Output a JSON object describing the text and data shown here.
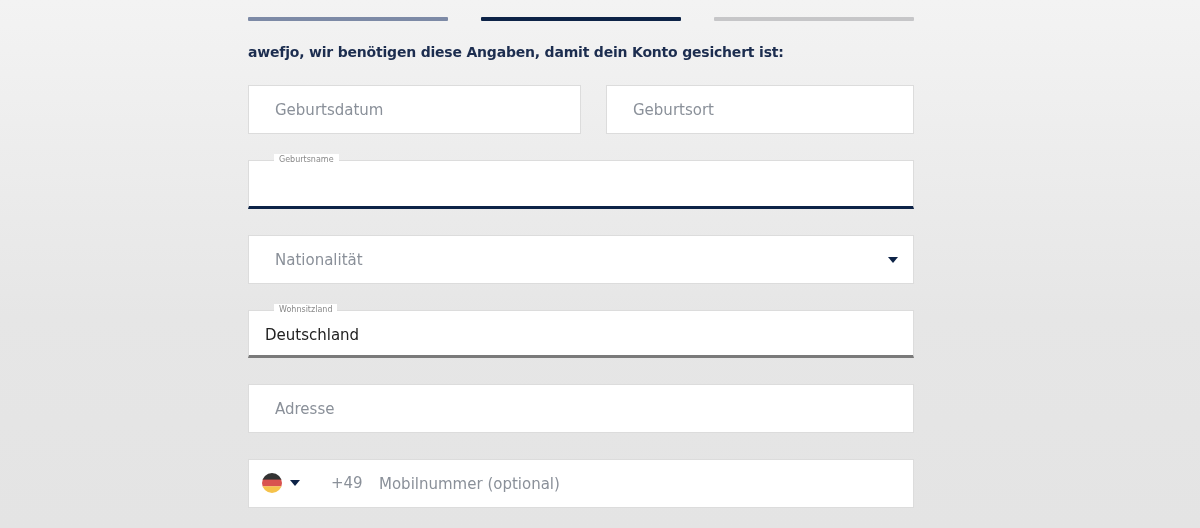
{
  "progress": [
    {
      "completed": true,
      "selected": false
    },
    {
      "completed": false,
      "selected": true
    },
    {
      "completed": false,
      "selected": false
    }
  ],
  "heading": "awefjo, wir benötigen diese Angaben, damit dein Konto gesichert ist:",
  "rows": [
    {
      "fields": [
        {
          "kind": "text",
          "placeholder": "Geburtsdatum",
          "focused": false
        },
        {
          "kind": "text",
          "placeholder": "Geburtsort",
          "focused": false
        }
      ]
    },
    {
      "fields": [
        {
          "kind": "text",
          "label": "Geburtsname",
          "focused": true
        }
      ]
    },
    {
      "fields": [
        {
          "kind": "select",
          "placeholder": "Nationalität",
          "focused": false
        }
      ]
    },
    {
      "fields": [
        {
          "kind": "text",
          "label": "Wohnsitzland",
          "value": "Deutschland",
          "focused": false
        }
      ]
    },
    {
      "fields": [
        {
          "kind": "text",
          "placeholder": "Adresse",
          "focused": false
        }
      ]
    },
    {
      "fields": [
        {
          "kind": "phone",
          "prefix": "+49",
          "placeholder": "Mobilnummer (optional)",
          "focused": false
        }
      ]
    }
  ]
}
